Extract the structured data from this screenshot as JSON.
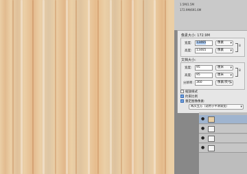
{
  "info": {
    "lines": [
      "1.5M/1.5M",
      "172.9M/691.6M"
    ]
  },
  "image_size_dialog": {
    "pixel_dimensions_label": "像素大小: 172.9M",
    "pixel": {
      "width_label": "宽度:",
      "width_value": "13465",
      "width_unit": "像素",
      "height_label": "高度:",
      "height_value": "13465",
      "height_unit": "像素"
    },
    "document_size_label": "文档大小:",
    "document": {
      "width_label": "宽度:",
      "width_value": "95",
      "width_unit": "厘米",
      "height_label": "高度:",
      "height_value": "95",
      "height_unit": "厘米",
      "resolution_label": "分辨率:",
      "resolution_value": "360",
      "resolution_unit": "像素/英寸"
    },
    "options": {
      "scale_styles": {
        "label": "缩放样式",
        "checked": false
      },
      "constrain_proportions": {
        "label": "约束比例",
        "checked": true
      },
      "resample": {
        "label": "重定图像像素:",
        "checked": true
      }
    },
    "resample_method": "两次立方（适用于平滑渐变）",
    "chain_symbol": "8"
  },
  "layers": {
    "rows": [
      {
        "visible": true,
        "active": true
      },
      {
        "visible": true,
        "active": false
      },
      {
        "visible": true,
        "active": false
      },
      {
        "visible": true,
        "active": false
      }
    ]
  },
  "colors": {
    "wood_base": "#ebcfa6",
    "dialog_bg": "#e6e6e6",
    "selection": "#a8c8f0"
  }
}
